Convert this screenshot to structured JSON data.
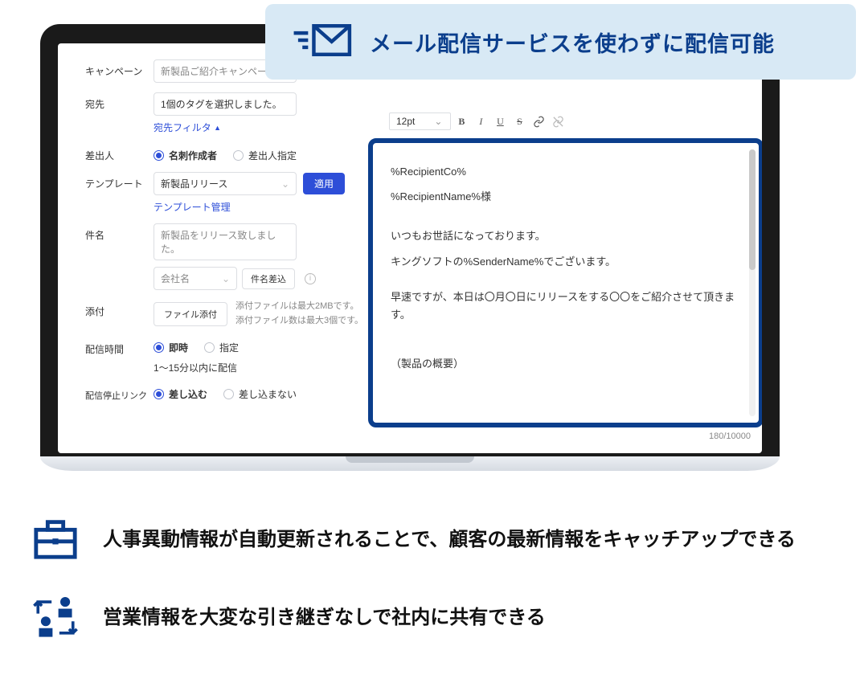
{
  "banner": {
    "headline": "メール配信サービスを使わずに配信可能"
  },
  "form": {
    "campaign": {
      "label": "キャンペーン",
      "placeholder": "新製品ご紹介キャンペー"
    },
    "to": {
      "label": "宛先",
      "value": "1個のタグを選択しました。",
      "filter_link": "宛先フィルタ"
    },
    "sender": {
      "label": "差出人",
      "opt1": "名刺作成者",
      "opt2": "差出人指定"
    },
    "template": {
      "label": "テンプレート",
      "value": "新製品リリース",
      "apply_btn": "適用",
      "manage_link": "テンプレート管理"
    },
    "subject": {
      "label": "件名",
      "placeholder": "新製品をリリース致しました。"
    },
    "subject_company": {
      "placeholder": "会社名",
      "insert_btn": "件名差込"
    },
    "attach": {
      "label": "添付",
      "btn": "ファイル添付",
      "note1": "添付ファイルは最大2MBです。",
      "note2": "添付ファイル数は最大3個です。"
    },
    "schedule": {
      "label": "配信時間",
      "opt1": "即時",
      "opt2": "指定",
      "note": "1～15分以内に配信"
    },
    "optout": {
      "label": "配信停止リンク",
      "opt1": "差し込む",
      "opt2": "差し込まない"
    }
  },
  "editor": {
    "font_size": "12pt",
    "tb_bold": "B",
    "tb_italic": "I",
    "tb_underline": "U",
    "tb_strike": "S",
    "body": {
      "l1": "%RecipientCo%",
      "l2": "%RecipientName%様",
      "l3": "いつもお世話になっております。",
      "l4": "キングソフトの%SenderName%でございます。",
      "l5": "早速ですが、本日は〇月〇日にリリースをする〇〇をご紹介させて頂きます。",
      "l6": "（製品の概要）"
    },
    "counter": "180/10000"
  },
  "features": {
    "f1": "人事異動情報が自動更新されることで、顧客の最新情報をキャッチアップできる",
    "f2": "営業情報を大変な引き継ぎなしで社内に共有できる"
  }
}
